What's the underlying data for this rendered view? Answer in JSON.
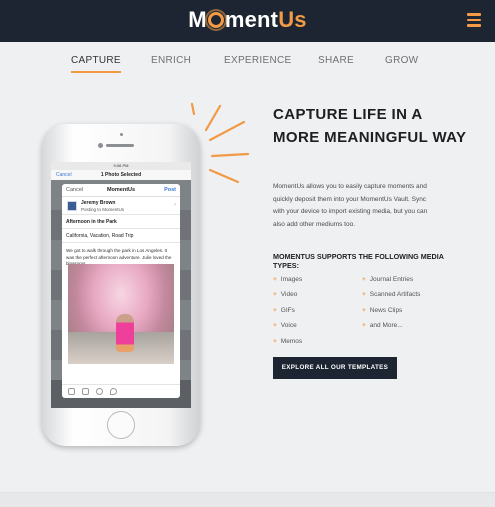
{
  "header": {
    "logo_part1": "M",
    "logo_part2": "ment",
    "logo_part3": "Us",
    "menu_icon": "hamburger-icon",
    "accent_color": "#f29a45",
    "background_color": "#1c2531"
  },
  "tabs": [
    {
      "label": "CAPTURE",
      "active": true
    },
    {
      "label": "ENRICH",
      "active": false
    },
    {
      "label": "EXPERIENCE",
      "active": false
    },
    {
      "label": "SHARE",
      "active": false
    },
    {
      "label": "GROW",
      "active": false
    }
  ],
  "phone": {
    "status_time": "9:06 PM",
    "photo_bar_cancel": "Cancel",
    "photo_bar_title": "1 Photo Selected",
    "card": {
      "cancel": "Cancel",
      "title": "MomentUs",
      "post": "Post",
      "account_name": "Jeremy Brown",
      "account_sub": "Posting to MomentUs",
      "entry_title": "Afternoon in the Park",
      "tags": "California, Vacation, Road Trip",
      "body": "We got to walk through the park in Los Angeles. It was the perfect afternoon adventure. Julie loved the blossoms."
    }
  },
  "content": {
    "headline": "CAPTURE LIFE IN A MORE MEANINGFUL WAY",
    "description": "MomentUs allows you to easily capture moments and quickly deposit them into your MomentUs Vault. Sync with your device to import existing media, but you can also add other mediums too.",
    "media_heading": "MOMENTUS SUPPORTS THE FOLLOWING MEDIA TYPES:",
    "media_left": [
      "Images",
      "Video",
      "GIFs",
      "Voice",
      "Memos"
    ],
    "media_right": [
      "Journal Entries",
      "Scanned Artifacts",
      "News Clips",
      "and More..."
    ],
    "cta_label": "EXPLORE ALL OUR TEMPLATES"
  }
}
